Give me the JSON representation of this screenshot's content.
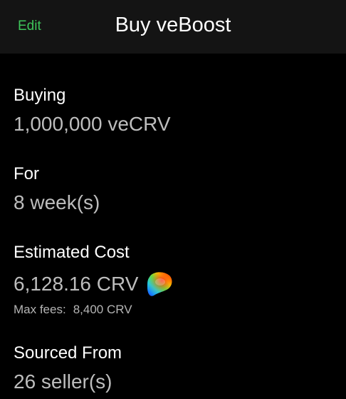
{
  "header": {
    "edit_label": "Edit",
    "title": "Buy veBoost"
  },
  "buying": {
    "label": "Buying",
    "value": "1,000,000 veCRV"
  },
  "duration": {
    "label": "For",
    "value": "8 week(s)"
  },
  "cost": {
    "label": "Estimated Cost",
    "value": "6,128.16 CRV",
    "token_icon": "crv-logo-icon",
    "max_fees_label": "Max fees:",
    "max_fees_value": "8,400 CRV"
  },
  "sourced": {
    "label": "Sourced From",
    "value": "26 seller(s)"
  },
  "colors": {
    "accent": "#3ec45a",
    "background": "#000000",
    "header_bg": "#141414"
  }
}
